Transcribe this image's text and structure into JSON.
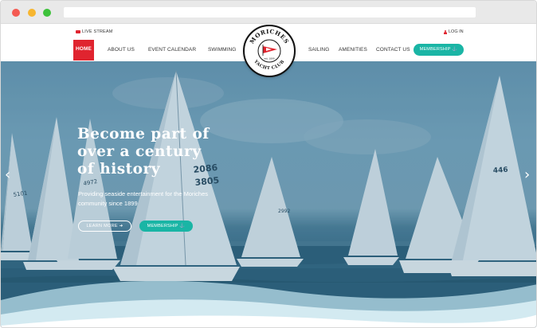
{
  "browser": {
    "buttons": [
      "close",
      "minimize",
      "maximize"
    ]
  },
  "utility": {
    "live_stream": "LIVE STREAM",
    "login": "LOG IN"
  },
  "nav": {
    "items": [
      {
        "label": "HOME",
        "active": true
      },
      {
        "label": "ABOUT US",
        "active": false
      },
      {
        "label": "EVENT CALENDAR",
        "active": false
      },
      {
        "label": "SWIMMING",
        "active": false
      },
      {
        "label": "SAILING",
        "active": false
      },
      {
        "label": "AMENITIES",
        "active": false
      },
      {
        "label": "CONTACT US",
        "active": false
      }
    ],
    "membership": "MEMBERSHIP"
  },
  "logo": {
    "top_text": "MORICHES",
    "bottom_text": "YACHT CLUB",
    "est": "est. 1899"
  },
  "hero": {
    "headline_lines": [
      "Become part of",
      "over a century",
      "of history"
    ],
    "subline_lines": [
      "Providing seaside entertainment for the Moriches",
      "community since 1899"
    ],
    "learn_more": "LEARN MORE",
    "membership": "MEMBERSHIP",
    "sail_numbers": [
      "2086",
      "3805",
      "5101",
      "4972",
      "446",
      "2992"
    ]
  },
  "colors": {
    "accent_red": "#e0242f",
    "teal": "#1ab5a5",
    "water": "#2d5c77"
  },
  "icons": [
    "camera-icon",
    "user-icon",
    "anchor-icon",
    "arrow-right-icon",
    "chevron-left-icon",
    "chevron-right-icon"
  ]
}
